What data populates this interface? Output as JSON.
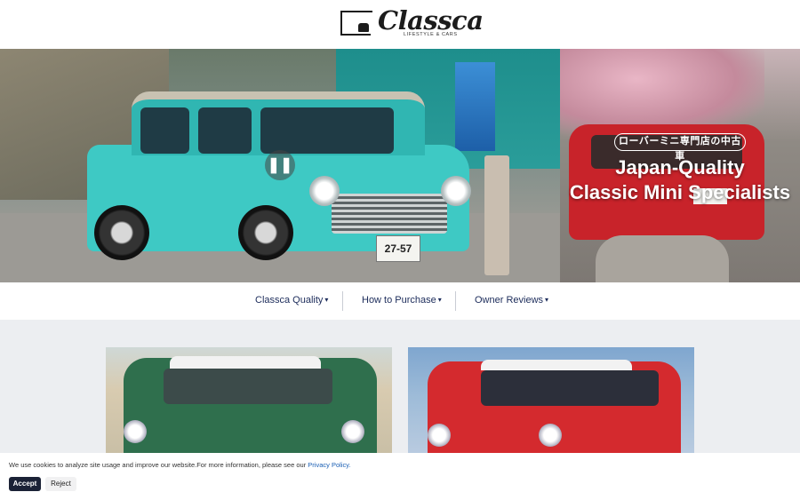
{
  "header": {
    "logo_word": "Classca",
    "logo_tagline": "LIFESTYLE & CARS"
  },
  "hero": {
    "badge": "ローバーミニ専門店の中古車",
    "title_line1": "Japan-Quality",
    "title_line2": "Classic Mini Specialists",
    "plate_text": "27-57",
    "pause_glyph": "❚❚",
    "pause_icon": "pause-icon"
  },
  "nav": {
    "items": [
      {
        "label": "Classca Quality",
        "caret": "▾"
      },
      {
        "label": "How to Purchase",
        "caret": "▾"
      },
      {
        "label": "Owner Reviews",
        "caret": "▾"
      }
    ]
  },
  "cookie": {
    "text": "We use cookies to analyze site usage and improve our website.For more information, please see our ",
    "link": "Privacy Policy.",
    "accept": "Accept",
    "reject": "Reject"
  },
  "colors": {
    "nav_text": "#1b2b5a",
    "accept_bg": "#1b2236",
    "link": "#1a5fb4"
  }
}
